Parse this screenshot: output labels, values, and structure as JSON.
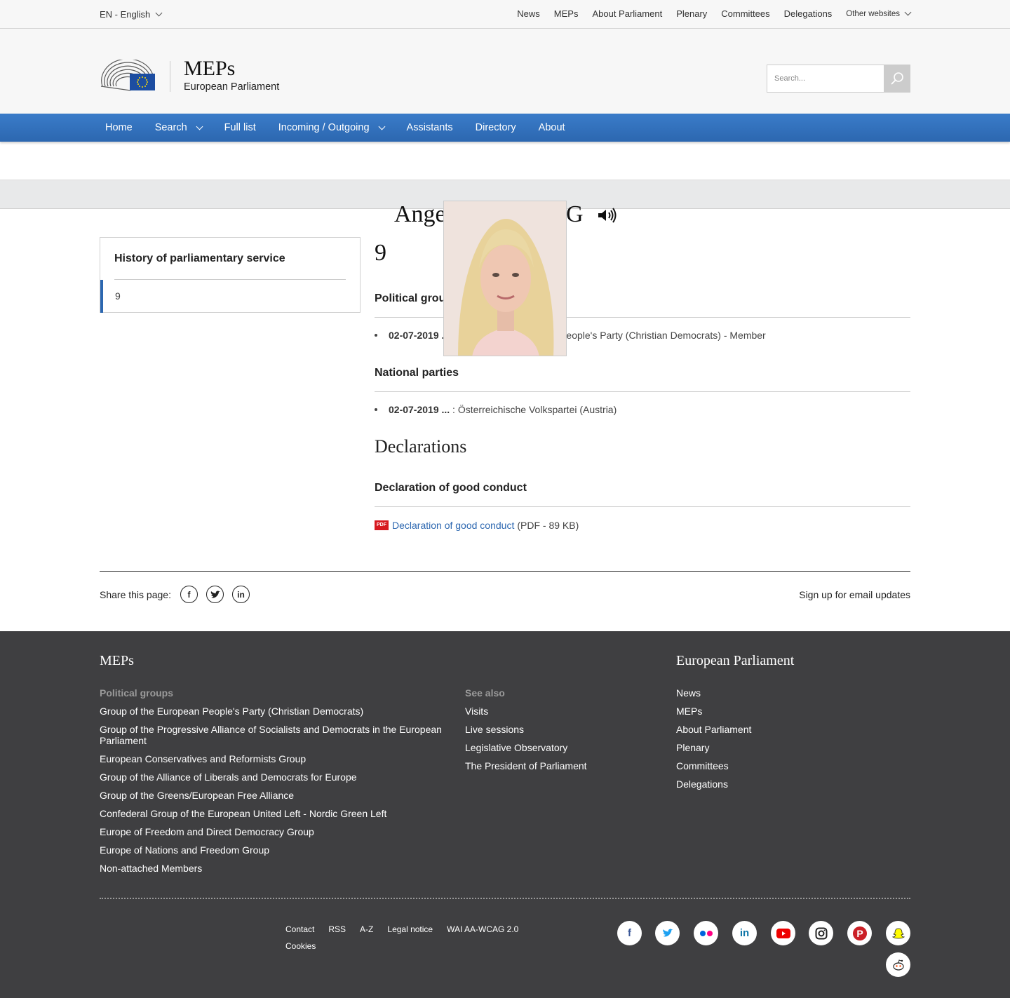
{
  "topbar": {
    "language": "EN - English",
    "links": [
      "News",
      "MEPs",
      "About Parliament",
      "Plenary",
      "Committees",
      "Delegations"
    ],
    "other_websites": "Other websites"
  },
  "header": {
    "title": "MEPs",
    "subtitle": "European Parliament",
    "search_placeholder": "Search..."
  },
  "nav": {
    "home": "Home",
    "search": "Search",
    "full_list": "Full list",
    "incoming_outgoing": "Incoming / Outgoing",
    "assistants": "Assistants",
    "directory": "Directory",
    "about": "About"
  },
  "profile": {
    "name_visible": "Ange",
    "name_visible_end": "IG",
    "term": "9"
  },
  "sidebar": {
    "title": "History of parliamentary service",
    "item": "9"
  },
  "main": {
    "political_groups_heading": "Political grou",
    "political_group_date": "02-07-2019 .",
    "political_group_text": "eople's Party (Christian Democrats) - Member",
    "national_parties_heading": "National parties",
    "national_party_date": "02-07-2019 ...",
    "national_party_text": " : Österreichische Volkspartei (Austria)",
    "declarations_heading": "Declarations",
    "good_conduct_heading": "Declaration of good conduct",
    "pdf_badge": "PDF",
    "pdf_link": "Declaration of good conduct",
    "pdf_meta": "(PDF - 89 KB)"
  },
  "share": {
    "label": "Share this page:",
    "signup": "Sign up for email updates"
  },
  "footer": {
    "meps_heading": "MEPs",
    "ep_heading": "European Parliament",
    "political_groups_label": "Political groups",
    "political_groups": [
      "Group of the European People's Party (Christian Democrats)",
      "Group of the Progressive Alliance of Socialists and Democrats in the European Parliament",
      "European Conservatives and Reformists Group",
      "Group of the Alliance of Liberals and Democrats for Europe",
      "Group of the Greens/European Free Alliance",
      "Confederal Group of the European United Left - Nordic Green Left",
      "Europe of Freedom and Direct Democracy Group",
      "Europe of Nations and Freedom Group",
      "Non-attached Members"
    ],
    "see_also_label": "See also",
    "see_also": [
      "Visits",
      "Live sessions",
      "Legislative Observatory",
      "The President of Parliament"
    ],
    "ep_links": [
      "News",
      "MEPs",
      "About Parliament",
      "Plenary",
      "Committees",
      "Delegations"
    ],
    "bottom_links": [
      "Contact",
      "RSS",
      "A-Z",
      "Legal notice",
      "WAI AA-WCAG 2.0",
      "Cookies"
    ],
    "social": [
      "facebook-icon",
      "twitter-icon",
      "flickr-icon",
      "linkedin-icon",
      "youtube-icon",
      "instagram-icon",
      "pinterest-icon",
      "snapchat-icon",
      "reddit-icon"
    ]
  },
  "colors": {
    "nav_blue": "#2c67b0",
    "footer_bg": "#3f3f41",
    "pdf_red": "#d71920"
  }
}
